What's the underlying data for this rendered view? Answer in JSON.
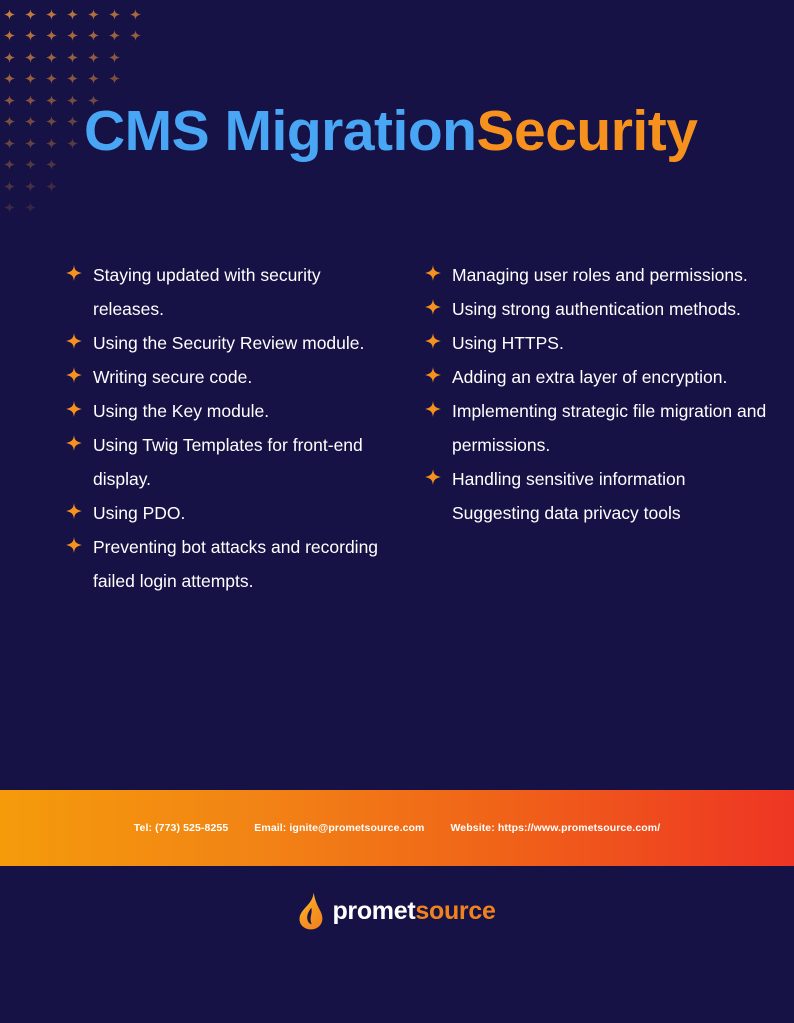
{
  "colors": {
    "background": "#161245",
    "title_primary": "#48A6F4",
    "title_accent": "#F7911E",
    "bullet": "#F7911E",
    "bar_gradient_start": "#F59B0B",
    "bar_gradient_end": "#EE3524",
    "body_text": "#FFFFFF",
    "brand_accent": "#F0821E"
  },
  "decor": {
    "sparkle_icon": "four-point-star-icon",
    "sparkle_color": "#C87D3C"
  },
  "header": {
    "title_primary": "CMS Migration",
    "title_accent": "Security"
  },
  "checklist": {
    "bullet_icon": "four-point-star-bullet-icon",
    "left_column": [
      {
        "text": "Staying updated with security releases.",
        "bulleted": true
      },
      {
        "text": "Using the Security Review module.",
        "bulleted": true
      },
      {
        "text": "Writing secure code.",
        "bulleted": true
      },
      {
        "text": "Using the Key module.",
        "bulleted": true
      },
      {
        "text": "Using Twig Templates for front-end display.",
        "bulleted": true
      },
      {
        "text": "Using PDO.",
        "bulleted": true
      },
      {
        "text": "Preventing bot attacks and recording failed login attempts.",
        "bulleted": true
      }
    ],
    "right_column": [
      {
        "text": "Managing user roles and permissions.",
        "bulleted": true
      },
      {
        "text": "Using strong authentication methods.",
        "bulleted": true
      },
      {
        "text": "Using HTTPS.",
        "bulleted": true
      },
      {
        "text": "Adding an extra layer of encryption.",
        "bulleted": true
      },
      {
        "text": "Implementing strategic file migration and permissions.",
        "bulleted": true
      },
      {
        "text": "Handling sensitive information",
        "bulleted": true
      },
      {
        "text": "Suggesting data privacy tools",
        "bulleted": false
      }
    ]
  },
  "contact_bar": {
    "phone": "Tel: (773) 525-8255",
    "email": "Email: ignite@prometsource.com",
    "website": "Website: https://www.prometsource.com/"
  },
  "brand": {
    "logo_icon": "promet-flame-icon",
    "name_part1": "promet",
    "name_part2": "source"
  }
}
